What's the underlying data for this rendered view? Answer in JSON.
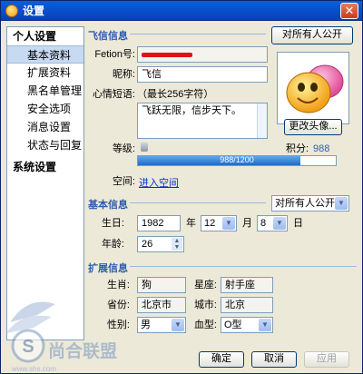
{
  "window": {
    "title": "设置",
    "close_glyph": "✕"
  },
  "sidebar": {
    "groups": [
      {
        "label": "个人设置",
        "items": [
          "基本资料",
          "扩展资料",
          "黑名单管理",
          "安全选项",
          "消息设置",
          "状态与回复"
        ]
      },
      {
        "label": "系统设置"
      }
    ],
    "active_item": "基本资料"
  },
  "fetion_info": {
    "section_title": "飞信信息",
    "privacy_button": "对所有人公开",
    "fetion_id_label": "Fetion号:",
    "fetion_id_value": "",
    "nickname_label": "昵称:",
    "nickname_value": "飞信",
    "mood_label": "心情短语:",
    "mood_hint": "（最长256字符）",
    "mood_value": "飞跃无限，信步天下。",
    "change_avatar_button": "更改头像...",
    "level_label": "等级:",
    "points_label": "积分:",
    "points_value": "988",
    "level_progress_text": "988/1200",
    "level_progress_fraction": 0.823,
    "space_label": "空间:",
    "space_link": "进入空间"
  },
  "basic_info": {
    "section_title": "基本信息",
    "privacy_select": "对所有人公开",
    "birthday_label": "生日:",
    "year_value": "1982",
    "year_unit": "年",
    "month_value": "12",
    "month_unit": "月",
    "day_value": "8",
    "day_unit": "日",
    "age_label": "年龄:",
    "age_value": "26"
  },
  "extended_info": {
    "section_title": "扩展信息",
    "zodiac_label": "生肖:",
    "zodiac_value": "狗",
    "constellation_label": "星座:",
    "constellation_value": "射手座",
    "province_label": "省份:",
    "province_value": "北京市",
    "city_label": "城市:",
    "city_value": "北京",
    "gender_label": "性别:",
    "gender_value": "男",
    "blood_label": "血型:",
    "blood_value": "O型"
  },
  "footer": {
    "ok": "确定",
    "cancel": "取消",
    "apply": "应用"
  },
  "watermark": {
    "text": "尚合联盟",
    "url": "www.shs.com"
  },
  "colors": {
    "titlebar": "#0A5FDB",
    "accent": "#2E5BB0",
    "progress": "#1E6CC8"
  }
}
